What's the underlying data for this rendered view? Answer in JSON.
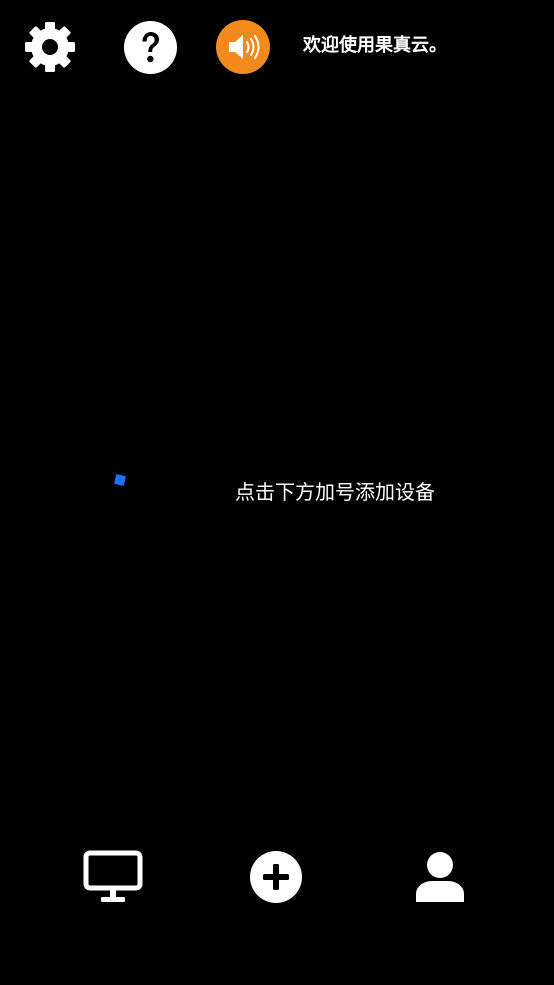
{
  "header": {
    "settings_icon": "gear-icon",
    "help_icon": "question-icon",
    "sound_icon": "speaker-icon",
    "welcome_text": "欢迎使用果真云。"
  },
  "main": {
    "empty_hint": "点击下方加号添加设备",
    "loading_indicator_color": "#1e6ff5"
  },
  "bottom_nav": {
    "items": [
      {
        "icon": "monitor-icon"
      },
      {
        "icon": "plus-circle-icon"
      },
      {
        "icon": "user-icon"
      }
    ]
  },
  "colors": {
    "background": "#000000",
    "foreground": "#ffffff",
    "accent": "#f28a1e"
  }
}
